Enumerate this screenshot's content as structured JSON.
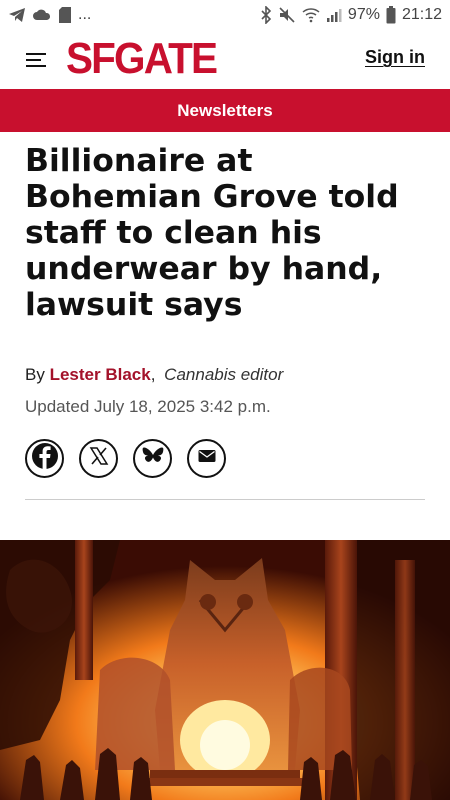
{
  "status_bar": {
    "left_dots": "...",
    "battery_percent": "97%",
    "time": "21:12",
    "icons": [
      "telegram-icon",
      "cloud-icon",
      "sd-card-icon",
      "bluetooth-icon",
      "mute-icon",
      "wifi-icon",
      "signal-icon",
      "battery-icon"
    ]
  },
  "header": {
    "logo": "SFGATE",
    "sign_in": "Sign in",
    "brand_color": "#c8102e"
  },
  "newsletter_bar": {
    "label": "Newsletters"
  },
  "article": {
    "headline": "Billionaire at Bohemian Grove told staff to clean his underwear by hand, lawsuit says",
    "by_prefix": "By",
    "author": "Lester Black",
    "author_role": "Cannabis editor",
    "updated": "Updated July 18, 2025 3:42 p.m."
  },
  "share": {
    "icons": [
      "facebook-icon",
      "x-icon",
      "bluesky-icon",
      "email-icon"
    ]
  }
}
